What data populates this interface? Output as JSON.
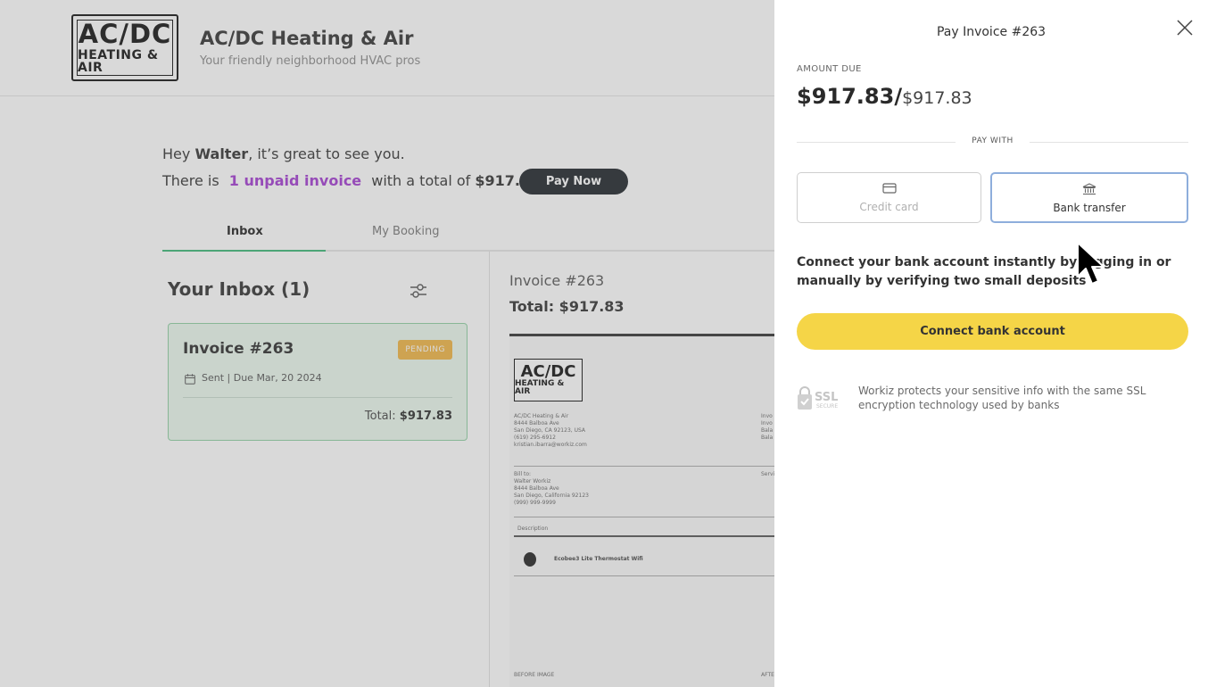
{
  "company": {
    "logo_line1": "AC/DC",
    "logo_line2": "HEATING & AIR",
    "name": "AC/DC Heating & Air",
    "tagline": "Your friendly neighborhood HVAC pros"
  },
  "greeting": {
    "prefix": "Hey",
    "user": "Walter",
    "suffix": ", it’s great to see you.",
    "line2_prefix": "There is",
    "unpaid_link": "1 unpaid invoice",
    "line2_middle": "with a total of",
    "total": "$917.83",
    "pay_now": "Pay Now"
  },
  "tabs": [
    {
      "label": "Inbox",
      "active": true
    },
    {
      "label": "My Booking",
      "active": false
    }
  ],
  "inbox": {
    "title": "Your Inbox (1)",
    "card": {
      "title": "Invoice #263",
      "status": "PENDING",
      "due": "Sent | Due Mar, 20 2024",
      "total_label": "Total:",
      "total_value": "$917.83"
    }
  },
  "detail": {
    "invoice_number": "Invoice #263",
    "total": "Total: $917.83",
    "doc": {
      "logo_line1": "AC/DC",
      "logo_line2": "HEATING & AIR",
      "from_lines": [
        "AC/DC Heating & Air",
        "8444 Balboa Ave",
        "San Diego, CA 92123, USA",
        "(619) 295-6912",
        "kristian.ibarra@workiz.com"
      ],
      "bill_to": [
        "Bill to:",
        "Walter Workiz",
        "8444 Balboa Ave",
        "San Diego, California 92123",
        "(999) 999-9999"
      ],
      "description_label": "Description",
      "item": "Ecobee3 Lite Thermostat Wifi",
      "before_image": "BEFORE IMAGE",
      "right_cut": [
        "Invo",
        "Invo",
        "Bala",
        "Bala",
        "Servi",
        "AFTE"
      ]
    }
  },
  "pay_panel": {
    "title": "Pay Invoice #263",
    "amount_label": "AMOUNT DUE",
    "amount_big": "$917.83/",
    "amount_small": "$917.83",
    "pay_with": "PAY WITH",
    "methods": [
      {
        "label": "Credit card",
        "icon": "credit-card-icon",
        "selected": false
      },
      {
        "label": "Bank transfer",
        "icon": "bank-icon",
        "selected": true
      }
    ],
    "description": "Connect your bank account instantly by logging in or manually by verifying two small deposits",
    "connect_button": "Connect bank account",
    "ssl_badge_text": "SSL",
    "ssl_badge_sub": "SECURE",
    "ssl_text": "Workiz protects your sensitive info with the same SSL encryption technology used by banks"
  },
  "colors": {
    "accent_green": "#3cb878",
    "link_purple": "#a23bd1",
    "pending_orange": "#f0b443",
    "connect_yellow": "#f5d547",
    "selected_border": "#8eaedc"
  }
}
